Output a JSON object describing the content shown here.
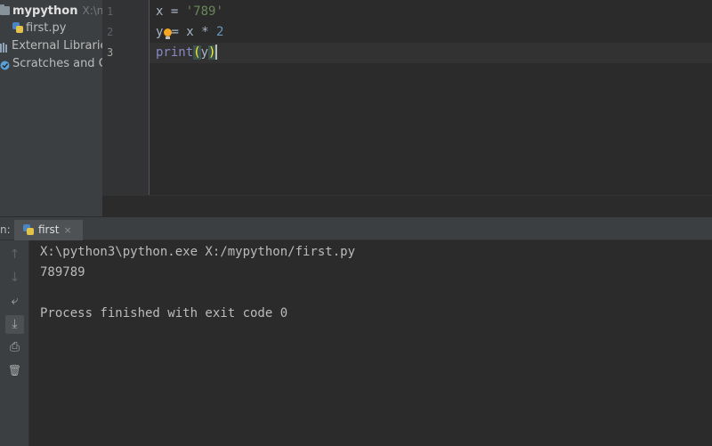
{
  "project": {
    "root": {
      "name": "mypython",
      "path": "X:\\my"
    },
    "items": [
      {
        "label": "first.py"
      },
      {
        "label": "External Libraries"
      },
      {
        "label": "Scratches and Co"
      }
    ]
  },
  "editor": {
    "line_numbers": [
      "1",
      "2",
      "3"
    ],
    "lines": [
      {
        "var": "x",
        "op": " = ",
        "str": "'789'"
      },
      {
        "var": "y",
        "op": "= x * ",
        "num": "2"
      },
      {
        "func": "print",
        "open": "(",
        "arg": "y",
        "close": ")"
      }
    ],
    "current_line": 3,
    "colors": {
      "string": "#6a8759",
      "number": "#6897bb",
      "builtin": "#8888c6",
      "paren_match": "#ffef28"
    }
  },
  "run": {
    "panel_label": "n:",
    "tab": {
      "label": "first",
      "close": "×"
    },
    "toolbar": [
      {
        "icon": "arrow-up-icon",
        "glyph": "↑"
      },
      {
        "icon": "arrow-down-icon",
        "glyph": "↓"
      },
      {
        "icon": "soft-wrap-icon",
        "glyph": "⤶"
      },
      {
        "icon": "scroll-to-end-icon",
        "glyph": "⤓"
      },
      {
        "icon": "print-icon",
        "glyph": "⎙"
      },
      {
        "icon": "trash-icon",
        "glyph": "🗑"
      }
    ],
    "console": [
      "X:\\python3\\python.exe X:/mypython/first.py",
      "789789",
      "",
      "Process finished with exit code 0"
    ]
  }
}
